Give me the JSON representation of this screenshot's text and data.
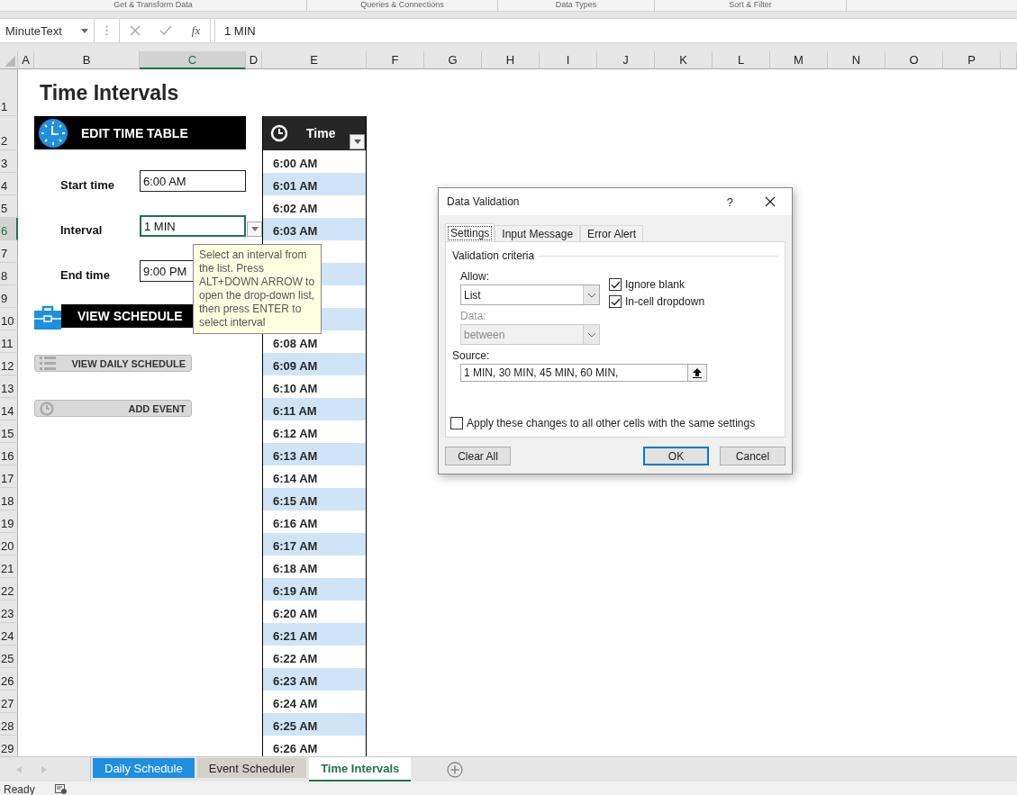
{
  "ribbon_groups": [
    "Get & Transform Data",
    "Queries & Connections",
    "Data Types",
    "Sort & Filter"
  ],
  "formula_bar": {
    "name_box": "MinuteText",
    "function_label": "fx",
    "formula": "1 MIN"
  },
  "columns": [
    {
      "label": "A",
      "selected": false
    },
    {
      "label": "B",
      "selected": false
    },
    {
      "label": "C",
      "selected": true
    },
    {
      "label": "D",
      "selected": false
    },
    {
      "label": "E",
      "selected": false
    },
    {
      "label": "F",
      "selected": false
    },
    {
      "label": "G",
      "selected": false
    },
    {
      "label": "H",
      "selected": false
    },
    {
      "label": "I",
      "selected": false
    },
    {
      "label": "J",
      "selected": false
    },
    {
      "label": "K",
      "selected": false
    },
    {
      "label": "L",
      "selected": false
    },
    {
      "label": "M",
      "selected": false
    },
    {
      "label": "N",
      "selected": false
    },
    {
      "label": "O",
      "selected": false
    },
    {
      "label": "P",
      "selected": false
    }
  ],
  "rows": [
    {
      "label": "1",
      "selected": false
    },
    {
      "label": "2",
      "selected": false
    },
    {
      "label": "3",
      "selected": false
    },
    {
      "label": "4",
      "selected": false
    },
    {
      "label": "5",
      "selected": false
    },
    {
      "label": "6",
      "selected": true
    },
    {
      "label": "7",
      "selected": false
    },
    {
      "label": "8",
      "selected": false
    },
    {
      "label": "9",
      "selected": false
    },
    {
      "label": "10",
      "selected": false
    },
    {
      "label": "11",
      "selected": false
    },
    {
      "label": "12",
      "selected": false
    },
    {
      "label": "13",
      "selected": false
    },
    {
      "label": "14",
      "selected": false
    },
    {
      "label": "15",
      "selected": false
    },
    {
      "label": "16",
      "selected": false
    },
    {
      "label": "17",
      "selected": false
    },
    {
      "label": "18",
      "selected": false
    },
    {
      "label": "19",
      "selected": false
    },
    {
      "label": "20",
      "selected": false
    },
    {
      "label": "21",
      "selected": false
    },
    {
      "label": "22",
      "selected": false
    },
    {
      "label": "23",
      "selected": false
    },
    {
      "label": "24",
      "selected": false
    },
    {
      "label": "25",
      "selected": false
    },
    {
      "label": "26",
      "selected": false
    },
    {
      "label": "27",
      "selected": false
    },
    {
      "label": "28",
      "selected": false
    },
    {
      "label": "29",
      "selected": false
    }
  ],
  "sheet": {
    "title": "Time Intervals",
    "edit_button": "EDIT TIME TABLE",
    "fields": [
      {
        "label": "Start time",
        "value": "6:00 AM",
        "selected": false
      },
      {
        "label": "Interval",
        "value": "1 MIN",
        "selected": true
      },
      {
        "label": "End time",
        "value": "9:00 PM",
        "selected": false
      }
    ],
    "view_schedule": "VIEW SCHEDULE",
    "buttons": [
      {
        "label": "VIEW DAILY SCHEDULE",
        "kind": "list"
      },
      {
        "label": "ADD EVENT",
        "kind": "clock"
      }
    ],
    "time_table": {
      "header": "Time",
      "times": [
        "6:00 AM",
        "6:01 AM",
        "6:02 AM",
        "6:03 AM"
      ],
      "times_after": [
        "6:08 AM",
        "6:09 AM",
        "6:10 AM",
        "6:11 AM",
        "6:12 AM",
        "6:13 AM",
        "6:14 AM",
        "6:15 AM",
        "6:16 AM",
        "6:17 AM",
        "6:18 AM",
        "6:19 AM",
        "6:20 AM",
        "6:21 AM",
        "6:22 AM",
        "6:23 AM",
        "6:24 AM",
        "6:25 AM",
        "6:26 AM"
      ]
    }
  },
  "tooltip": {
    "text": "Select an interval from the list. Press ALT+DOWN ARROW to open the drop-down list, then press ENTER to select interval"
  },
  "dialog": {
    "title": "Data Validation",
    "help": "?",
    "tabs": [
      {
        "label": "Settings",
        "selected": true
      },
      {
        "label": "Input Message",
        "selected": false
      },
      {
        "label": "Error Alert",
        "selected": false
      }
    ],
    "group_title": "Validation criteria",
    "allow": {
      "label": "Allow:",
      "value": "List",
      "disabled": false
    },
    "data": {
      "label": "Data:",
      "value": "between",
      "disabled": true
    },
    "checkboxes": [
      {
        "label": "Ignore blank",
        "checked": true
      },
      {
        "label": "In-cell dropdown",
        "checked": true
      }
    ],
    "source": {
      "label": "Source:",
      "value": "1 MIN, 30 MIN, 45 MIN, 60 MIN,"
    },
    "apply": {
      "label": "Apply these changes to all other cells with the same settings",
      "checked": false
    },
    "buttons": [
      {
        "label": "Clear All",
        "default": false
      },
      {
        "label": "OK",
        "default": true
      },
      {
        "label": "Cancel",
        "default": false
      }
    ]
  },
  "sheet_tabs": [
    {
      "label": "Daily Schedule",
      "selected": false,
      "color": "#1e8fe1"
    },
    {
      "label": "Event Scheduler",
      "selected": false,
      "color": "#d3d0c7"
    },
    {
      "label": "Time Intervals",
      "selected": true,
      "color": "#ffffff"
    }
  ],
  "status_bar": {
    "text": "Ready"
  }
}
